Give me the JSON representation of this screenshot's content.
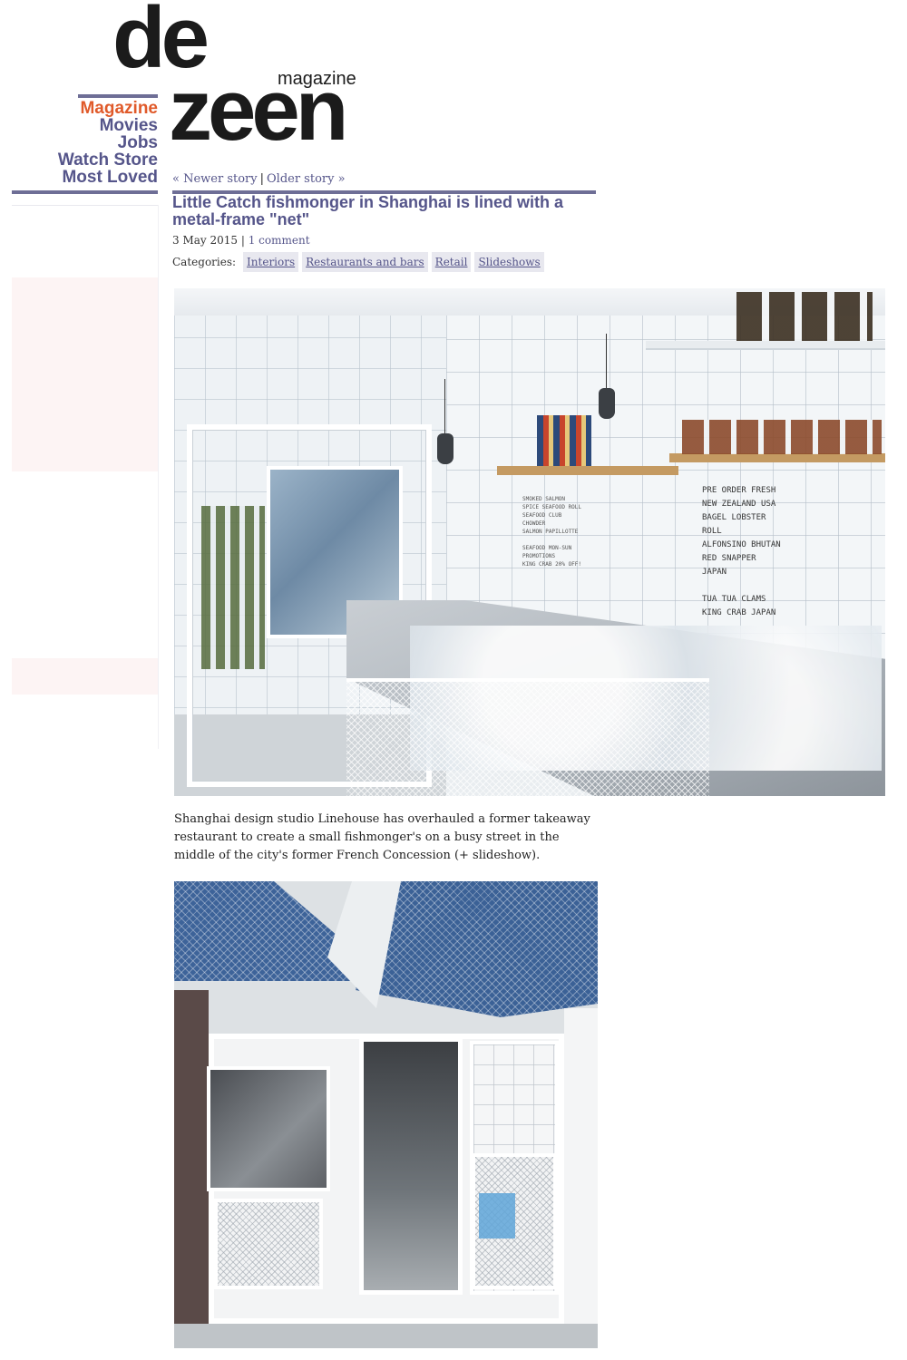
{
  "logo": {
    "line1": "de",
    "line2": "zeen",
    "tagline": "magazine"
  },
  "nav": {
    "items": [
      {
        "label": "Magazine",
        "active": true
      },
      {
        "label": "Movies"
      },
      {
        "label": "Jobs"
      },
      {
        "label": "Watch Store"
      },
      {
        "label": "Most Loved"
      }
    ]
  },
  "story_nav": {
    "newer": "« Newer story",
    "separator": "|",
    "older": "Older story »"
  },
  "article": {
    "title": "Little Catch fishmonger in Shanghai is lined with a metal-frame \"net\"",
    "date": "3 May 2015",
    "meta_separator": "|",
    "comments": "1 comment",
    "categories_label": "Categories:",
    "categories": [
      "Interiors",
      "Restaurants and bars",
      "Retail",
      "Slideshows"
    ],
    "body": "Shanghai design studio Linehouse has overhauled a former takeaway restaurant to create a small fishmonger's on a busy street in the middle of the city's former French Concession (+ slideshow)."
  },
  "photo1_sign": {
    "lines": [
      "PRE ORDER FRESH",
      "NEW ZEALAND  USA",
      "BAGEL LOBSTER ROLL",
      "ALFONSINO  BHUTAN",
      "RED SNAPPER JAPAN",
      "",
      "TUA TUA CLAMS",
      "KING CRAB JAPAN"
    ],
    "small_lines": [
      "SMOKED SALMON",
      "SPICE SEAFOOD ROLL",
      "SEAFOOD CLUB",
      "CHOWDER",
      "SALMON PAPILLOTTE",
      "",
      "SEAFOOD  MON-SUN",
      "PROMOTIONS",
      "KING CRAB 20% OFF!"
    ]
  },
  "colors": {
    "accent": "#55558a",
    "active": "#e05a2a",
    "rule": "#6e6e96",
    "tag_bg": "#e8e8ef"
  }
}
